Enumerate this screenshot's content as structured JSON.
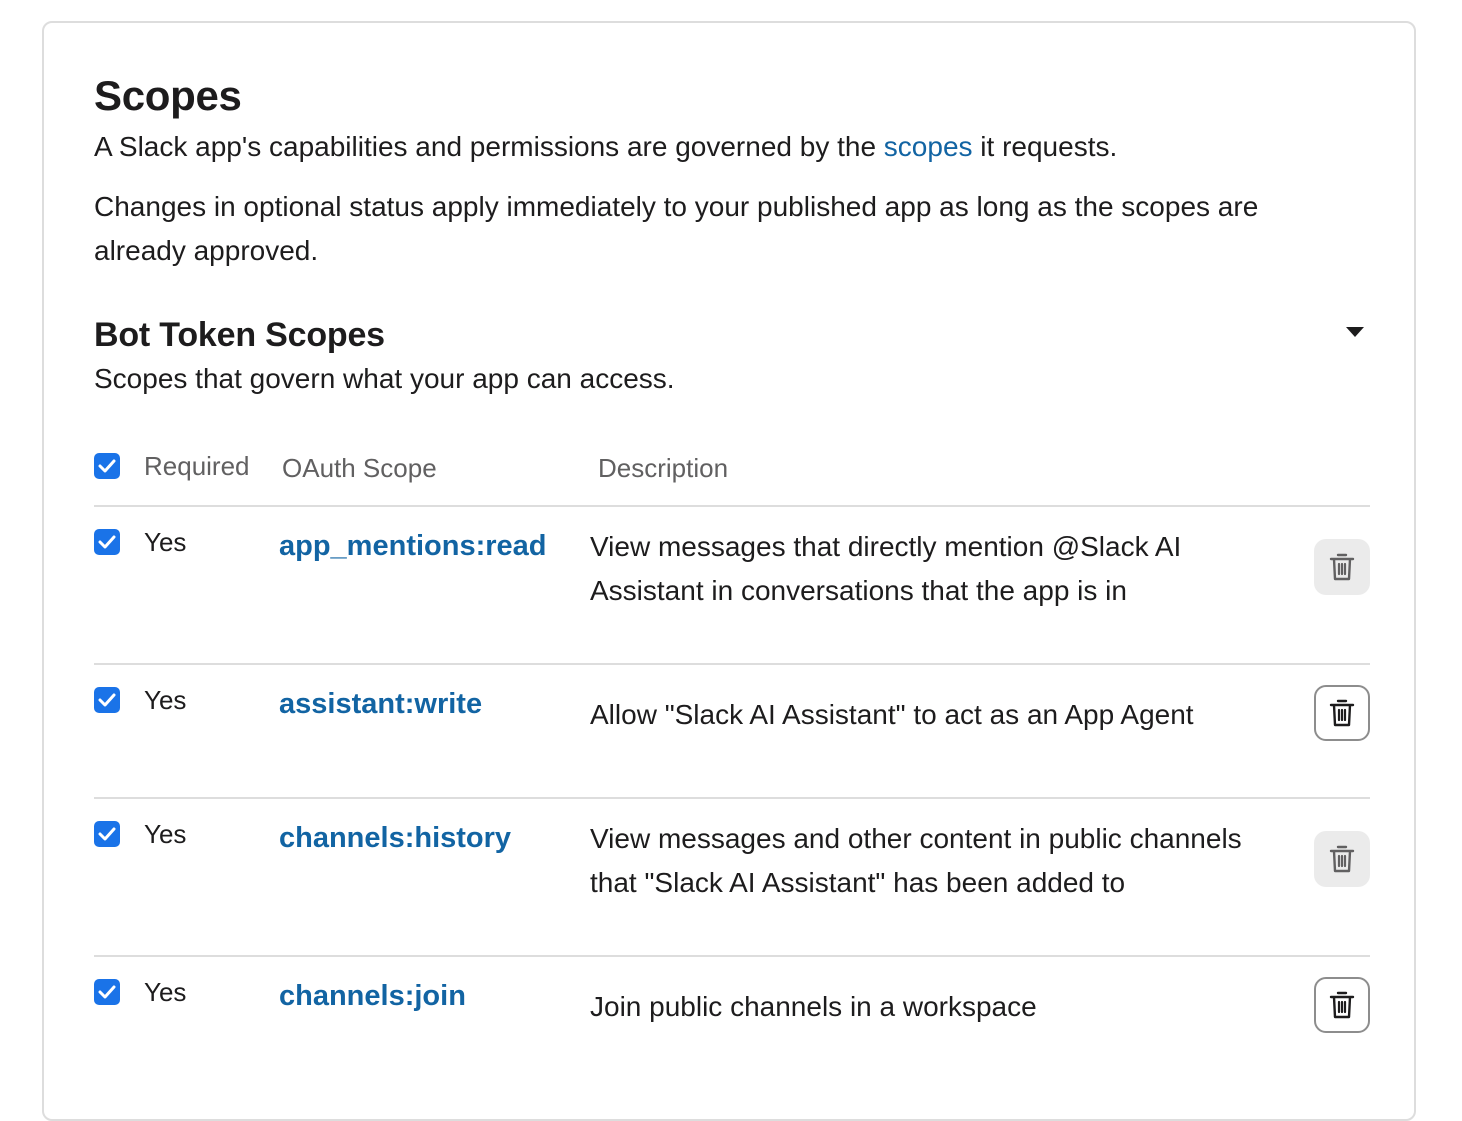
{
  "scopes": {
    "title": "Scopes",
    "intro_before_link": "A Slack app's capabilities and permissions are governed by the ",
    "intro_link": "scopes",
    "intro_after_link": " it requests.",
    "optional_note": "Changes in optional status apply immediately to your published app as long as the scopes are already approved."
  },
  "bot_token": {
    "title": "Bot Token Scopes",
    "subtitle": "Scopes that govern what your app can access.",
    "toggle_icon": "caret-down-icon"
  },
  "table": {
    "headers": {
      "required": "Required",
      "oauth_scope": "OAuth Scope",
      "description": "Description"
    },
    "rows": [
      {
        "required": "Yes",
        "scope": "app_mentions:read",
        "description": "View messages that directly mention @Slack AI Assistant in conversations that the app is in"
      },
      {
        "required": "Yes",
        "scope": "assistant:write",
        "description": "Allow \"Slack AI Assistant\" to act as an App Agent"
      },
      {
        "required": "Yes",
        "scope": "channels:history",
        "description": "View messages and other content in public channels that \"Slack AI Assistant\" has been added to"
      },
      {
        "required": "Yes",
        "scope": "channels:join",
        "description": "Join public channels in a workspace"
      }
    ]
  },
  "colors": {
    "link": "#1264a3",
    "checkbox": "#1a73e8",
    "border": "#dddddd",
    "muted_text": "#616061"
  }
}
